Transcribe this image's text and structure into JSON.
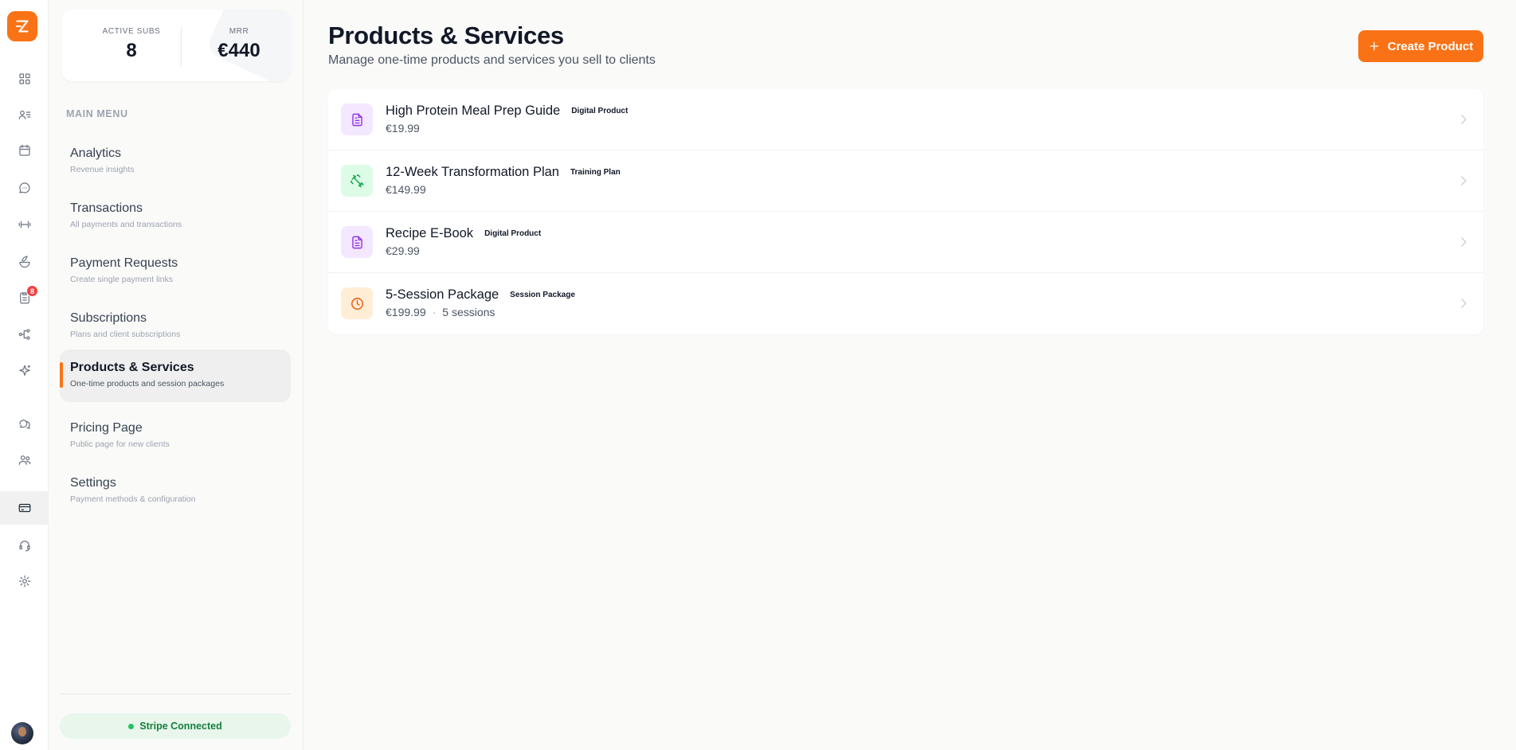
{
  "stats": {
    "active_subs_label": "ACTIVE SUBS",
    "active_subs_value": "8",
    "mrr_label": "MRR",
    "mrr_value": "€440"
  },
  "rail": {
    "badge_count": "8",
    "icons": [
      "grid-icon",
      "clients-list-icon",
      "calendar-icon",
      "chat-icon",
      "dumbbell-icon",
      "nutrition-icon",
      "clipboard-icon",
      "workflow-icon",
      "sparkle-icon",
      "messages-icon",
      "community-icon",
      "payments-icon",
      "support-icon",
      "settings-icon"
    ]
  },
  "sidebar": {
    "menu_title": "MAIN MENU",
    "items": [
      {
        "title": "Analytics",
        "subtitle": "Revenue insights"
      },
      {
        "title": "Transactions",
        "subtitle": "All payments and transactions"
      },
      {
        "title": "Payment Requests",
        "subtitle": "Create single payment links"
      },
      {
        "title": "Subscriptions",
        "subtitle": "Plans and client subscriptions"
      },
      {
        "title": "Products & Services",
        "subtitle": "One-time products and session packages"
      },
      {
        "title": "Pricing Page",
        "subtitle": "Public page for new clients"
      },
      {
        "title": "Settings",
        "subtitle": "Payment methods & configuration"
      }
    ],
    "active_index": 4,
    "stripe_status": "Stripe Connected"
  },
  "main": {
    "title": "Products & Services",
    "subtitle": "Manage one-time products and services you sell to clients",
    "create_label": "Create Product",
    "products": [
      {
        "name": "High Protein Meal Prep Guide",
        "tag": "Digital Product",
        "price": "€19.99",
        "extra": "",
        "icon": "document-icon",
        "color": "purple"
      },
      {
        "name": "12-Week Transformation Plan",
        "tag": "Training Plan",
        "price": "€149.99",
        "extra": "",
        "icon": "dumbbell-icon",
        "color": "green"
      },
      {
        "name": "Recipe E-Book",
        "tag": "Digital Product",
        "price": "€29.99",
        "extra": "",
        "icon": "document-icon",
        "color": "purple"
      },
      {
        "name": "5-Session Package",
        "tag": "Session Package",
        "price": "€199.99",
        "extra": "5 sessions",
        "icon": "clock-icon",
        "color": "orange"
      }
    ]
  },
  "colors": {
    "accent": "#f97316",
    "success": "#22c55e",
    "badge": "#ef4444"
  }
}
